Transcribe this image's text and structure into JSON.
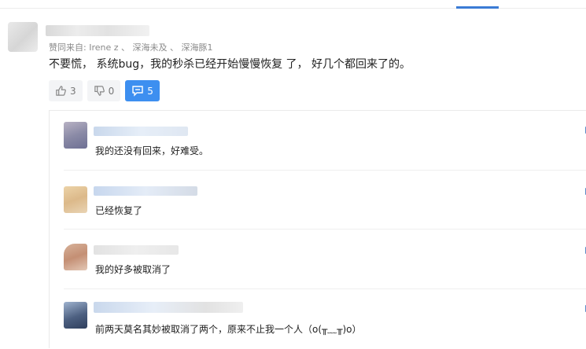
{
  "main_comment": {
    "likers_label": "赞同来自: Irene z 、 深海未及 、 深海豚1",
    "text": "不要慌， 系统bug，我的秒杀已经开始慢慢恢复 了， 好几个都回来了的。",
    "actions": {
      "like_count": "3",
      "dislike_count": "0",
      "comment_count": "5"
    }
  },
  "replies": [
    {
      "text": "我的还没有回来，好难受。"
    },
    {
      "text": "已经恢复了"
    },
    {
      "text": "我的好多被取消了"
    },
    {
      "text": "前两天莫名其妙被取消了两个，原来不止我一个人（o(╥﹏╥)o）"
    }
  ],
  "colors": {
    "accent": "#3d8ff0",
    "reply_icon": "#5a8bc8"
  },
  "icons": [
    "thumbs-up-icon",
    "thumbs-down-icon",
    "comment-icon",
    "reply-icon"
  ]
}
